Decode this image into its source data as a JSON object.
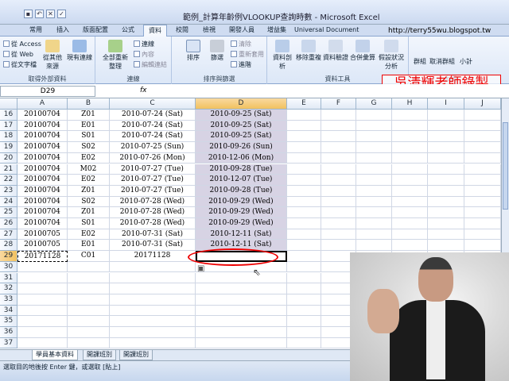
{
  "window": {
    "title": "範例_計算年齡例VLOOKUP查詢時數 - Microsoft Excel"
  },
  "ribbon_tabs": [
    "常用",
    "插入",
    "版面配置",
    "公式",
    "資料",
    "校閱",
    "檢視",
    "開發人員",
    "增益集",
    "Universal Document Converter"
  ],
  "ribbon": {
    "get_external": {
      "label": "取得外部資料",
      "items": [
        "從 Access",
        "從 Web",
        "從文字檔"
      ],
      "other_sources": "從其他來源",
      "existing": "現有連線"
    },
    "connections": {
      "label": "連線",
      "refresh_all": "全部重新整理",
      "items": [
        "連線",
        "內容",
        "編輯連結"
      ]
    },
    "sort_filter": {
      "label": "排序與篩選",
      "sort": "排序",
      "filter": "篩選",
      "items": [
        "清除",
        "重新套用",
        "進階"
      ]
    },
    "data_tools": {
      "label": "資料工具",
      "items": [
        "資料剖析",
        "移除重複",
        "資料驗證",
        "合併彙算",
        "假設狀況分析"
      ]
    },
    "outline": {
      "label": "大綱",
      "items": [
        "群組",
        "取消群組",
        "小計"
      ]
    }
  },
  "watermark": {
    "url": "http://terry55wu.blogspot.tw",
    "text": "吳清輝老師錄製"
  },
  "formula_bar": {
    "name_box": "D29",
    "fx": "fx",
    "content": ""
  },
  "columns": [
    "A",
    "B",
    "C",
    "D",
    "E",
    "F",
    "G",
    "H",
    "I",
    "J"
  ],
  "selected_column": "D",
  "rows": [
    {
      "num": "16",
      "a": "20100704",
      "b": "Z01",
      "c": "2010-07-24 (Sat)",
      "d": "2010-09-25 (Sat)"
    },
    {
      "num": "17",
      "a": "20100704",
      "b": "E01",
      "c": "2010-07-24 (Sat)",
      "d": "2010-09-25 (Sat)"
    },
    {
      "num": "18",
      "a": "20100704",
      "b": "S01",
      "c": "2010-07-24 (Sat)",
      "d": "2010-09-25 (Sat)"
    },
    {
      "num": "19",
      "a": "20100704",
      "b": "S02",
      "c": "2010-07-25 (Sun)",
      "d": "2010-09-26 (Sun)"
    },
    {
      "num": "20",
      "a": "20100704",
      "b": "E02",
      "c": "2010-07-26 (Mon)",
      "d": "2010-12-06 (Mon)"
    },
    {
      "num": "21",
      "a": "20100704",
      "b": "M02",
      "c": "2010-07-27 (Tue)",
      "d": "2010-09-28 (Tue)"
    },
    {
      "num": "22",
      "a": "20100704",
      "b": "E02",
      "c": "2010-07-27 (Tue)",
      "d": "2010-12-07 (Tue)"
    },
    {
      "num": "23",
      "a": "20100704",
      "b": "Z01",
      "c": "2010-07-27 (Tue)",
      "d": "2010-09-28 (Tue)"
    },
    {
      "num": "24",
      "a": "20100704",
      "b": "S02",
      "c": "2010-07-28 (Wed)",
      "d": "2010-09-29 (Wed)"
    },
    {
      "num": "25",
      "a": "20100704",
      "b": "Z01",
      "c": "2010-07-28 (Wed)",
      "d": "2010-09-29 (Wed)"
    },
    {
      "num": "26",
      "a": "20100704",
      "b": "S01",
      "c": "2010-07-28 (Wed)",
      "d": "2010-09-29 (Wed)"
    },
    {
      "num": "27",
      "a": "20100705",
      "b": "E02",
      "c": "2010-07-31 (Sat)",
      "d": "2010-12-11 (Sat)"
    },
    {
      "num": "28",
      "a": "20100705",
      "b": "E01",
      "c": "2010-07-31 (Sat)",
      "d": "2010-12-11 (Sat)"
    },
    {
      "num": "29",
      "a": "20171128",
      "b": "C01",
      "c": "20171128",
      "d": ""
    },
    {
      "num": "30",
      "a": "",
      "b": "",
      "c": "",
      "d": ""
    },
    {
      "num": "31",
      "a": "",
      "b": "",
      "c": "",
      "d": ""
    },
    {
      "num": "32",
      "a": "",
      "b": "",
      "c": "",
      "d": ""
    },
    {
      "num": "33",
      "a": "",
      "b": "",
      "c": "",
      "d": ""
    },
    {
      "num": "34",
      "a": "",
      "b": "",
      "c": "",
      "d": ""
    },
    {
      "num": "35",
      "a": "",
      "b": "",
      "c": "",
      "d": ""
    },
    {
      "num": "36",
      "a": "",
      "b": "",
      "c": "",
      "d": ""
    },
    {
      "num": "37",
      "a": "",
      "b": "",
      "c": "",
      "d": ""
    }
  ],
  "sheet_tabs": [
    "學員基本資料",
    "開課班別",
    "開課班別"
  ],
  "active_sheet_index": 0,
  "status": {
    "text": "選取目的地後按 Enter 鍵，或選取 [貼上]"
  }
}
